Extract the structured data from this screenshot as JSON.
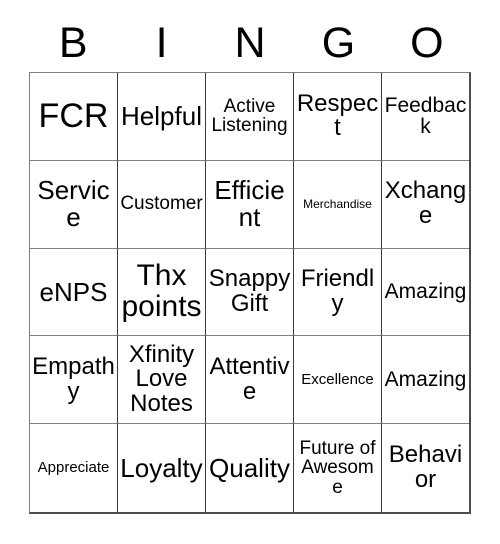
{
  "card": {
    "title_letters": [
      "B",
      "I",
      "N",
      "G",
      "O"
    ],
    "rows": [
      [
        {
          "text": "FCR",
          "size": "fs-xxl"
        },
        {
          "text": "Helpful",
          "size": "fs-lg"
        },
        {
          "text": "Active Listening",
          "size": "fs-xs"
        },
        {
          "text": "Respect",
          "size": "fs-md"
        },
        {
          "text": "Feedback",
          "size": "fs-sm"
        }
      ],
      [
        {
          "text": "Service",
          "size": "fs-lg"
        },
        {
          "text": "Customer",
          "size": "fs-xs"
        },
        {
          "text": "Efficient",
          "size": "fs-lg"
        },
        {
          "text": "Merchandise",
          "size": "fs-tiny"
        },
        {
          "text": "Xchange",
          "size": "fs-md"
        }
      ],
      [
        {
          "text": "eNPS",
          "size": "fs-lg"
        },
        {
          "text": "Thx points",
          "size": "fs-xl"
        },
        {
          "text": "Snappy Gift",
          "size": "fs-md"
        },
        {
          "text": "Friendly",
          "size": "fs-md"
        },
        {
          "text": "Amazing",
          "size": "fs-sm"
        }
      ],
      [
        {
          "text": "Empathy",
          "size": "fs-md"
        },
        {
          "text": "Xfinity Love Notes",
          "size": "fs-md"
        },
        {
          "text": "Attentive",
          "size": "fs-md"
        },
        {
          "text": "Excellence",
          "size": "fs-xxs"
        },
        {
          "text": "Amazing",
          "size": "fs-sm"
        }
      ],
      [
        {
          "text": "Appreciate",
          "size": "fs-xxs"
        },
        {
          "text": "Loyalty",
          "size": "fs-lg"
        },
        {
          "text": "Quality",
          "size": "fs-lg"
        },
        {
          "text": "Future of Awesome",
          "size": "fs-xs"
        },
        {
          "text": "Behavior",
          "size": "fs-md"
        }
      ]
    ]
  },
  "colors": {
    "background": "#ffffff",
    "text": "#000000",
    "grid_line": "#7f7f7f",
    "grid_line_dark": "#3a3a3a"
  }
}
